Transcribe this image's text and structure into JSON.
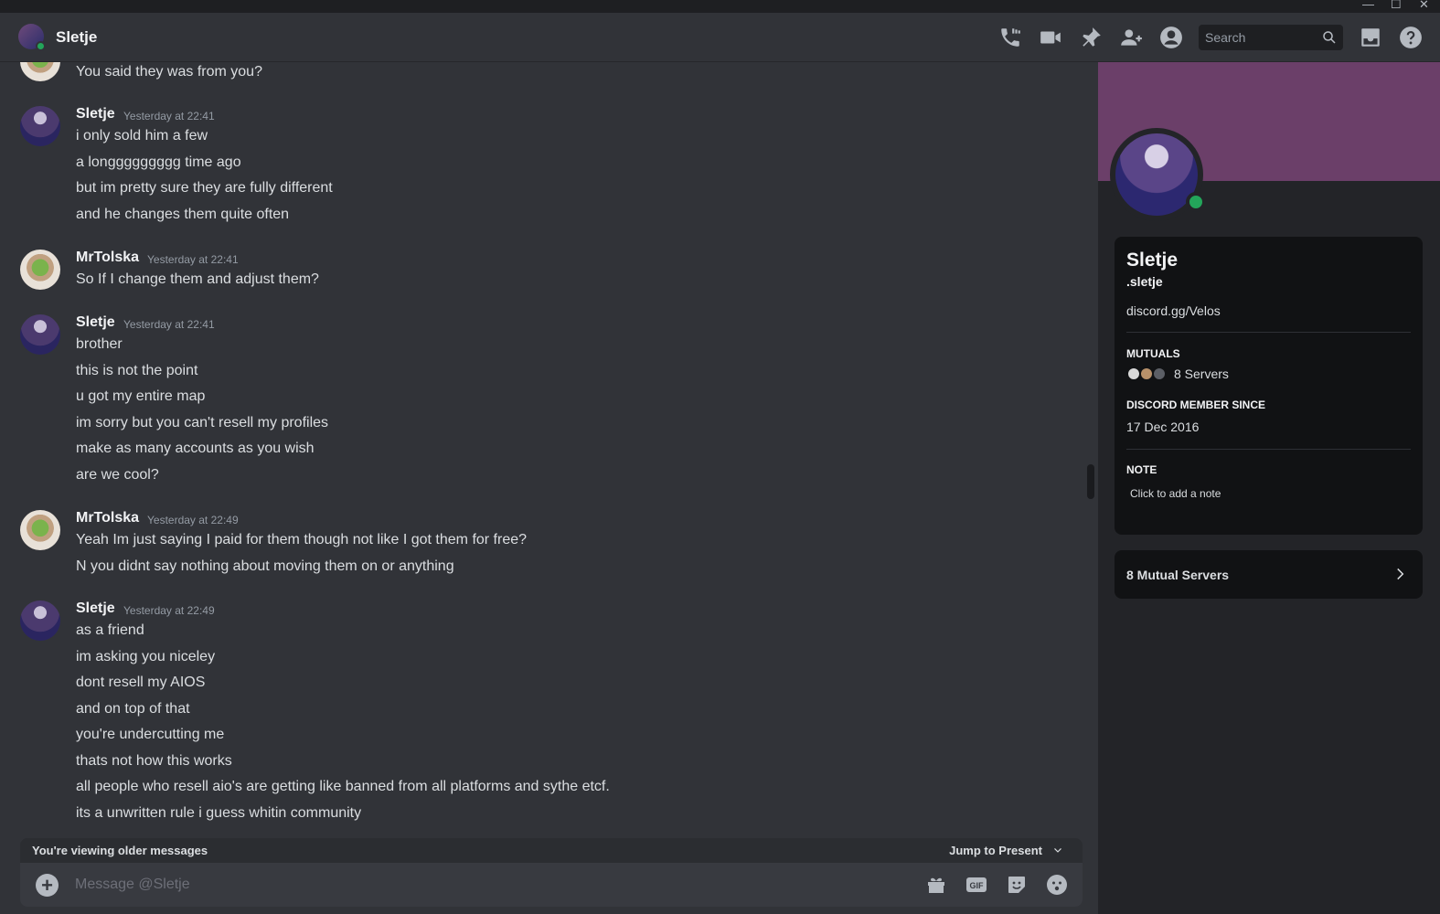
{
  "window": {
    "minimize": "—",
    "maximize": "☐",
    "close": "✕"
  },
  "header": {
    "name": "Sletje",
    "search_placeholder": "Search",
    "icons": [
      "phone-call-icon",
      "video-call-icon",
      "pin-icon",
      "add-friend-icon",
      "user-profile-icon",
      "search-icon",
      "inbox-icon",
      "help-icon"
    ]
  },
  "messages": [
    {
      "author": "",
      "timestamp": "",
      "lines": [
        "You said they was from you?"
      ]
    },
    {
      "author": "Sletje",
      "timestamp": "Yesterday at 22:41",
      "lines": [
        "i only sold him a few",
        "a longgggggggg time ago",
        "but im pretty sure they are fully different",
        "and he changes them quite often"
      ]
    },
    {
      "author": "MrTolska",
      "timestamp": "Yesterday at 22:41",
      "lines": [
        "So If I change them and adjust them?"
      ]
    },
    {
      "author": "Sletje",
      "timestamp": "Yesterday at 22:41",
      "lines": [
        "brother",
        "this is not the point",
        "u got my entire map",
        "im sorry but you can't resell my profiles",
        "make as many accounts as you wish",
        "are we cool?"
      ]
    },
    {
      "author": "MrTolska",
      "timestamp": "Yesterday at 22:49",
      "lines": [
        "Yeah Im just saying I paid for them though not like I got them for free?",
        "N you didnt say nothing about moving them on or anything"
      ]
    },
    {
      "author": "Sletje",
      "timestamp": "Yesterday at 22:49",
      "lines": [
        "as a friend",
        "im asking you niceley",
        "dont resell my AIOS",
        "and on top of that",
        "you're undercutting me",
        "thats not how this works",
        "all people who resell aio's are getting like banned from all platforms and sythe etcf.",
        "its a unwritten rule i guess whitin community"
      ]
    }
  ],
  "older_bar": {
    "text": "You're viewing older messages",
    "jump": "Jump to Present"
  },
  "composer": {
    "placeholder": "Message @Sletje"
  },
  "profile": {
    "display_name": "Sletje",
    "username": ".sletje",
    "bio": "discord.gg/Velos",
    "mutuals_heading": "MUTUALS",
    "mutuals_text": "8 Servers",
    "member_since_heading": "DISCORD MEMBER SINCE",
    "member_since": "17 Dec 2016",
    "note_heading": "NOTE",
    "note_placeholder": "Click to add a note",
    "mutual_servers_button": "8 Mutual Servers"
  },
  "colors": {
    "background": "#313338",
    "banner": "#6b3f69",
    "online": "#23a55a",
    "card": "#111214"
  }
}
